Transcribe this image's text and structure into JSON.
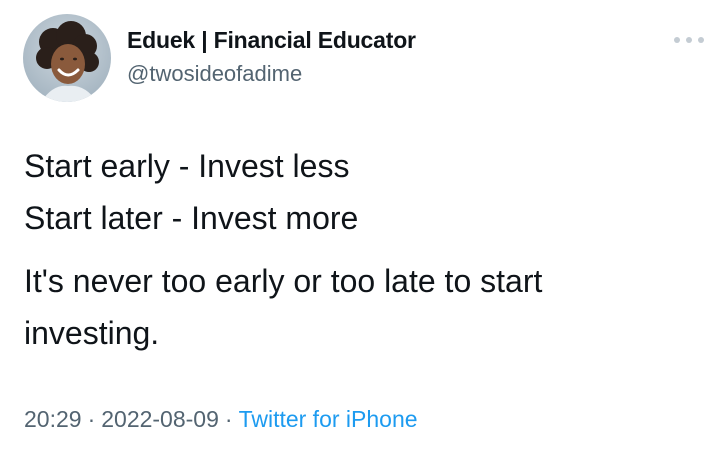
{
  "author": {
    "display_name": "Eduek | Financial Educator",
    "handle": "@twosideofadime",
    "avatar_icon": "profile-photo"
  },
  "more_icon": "more-horizontal-icon",
  "tweet": {
    "lines": [
      "Start early - Invest less",
      "Start later - Invest more",
      "It's never too early or too late to start",
      "investing."
    ]
  },
  "meta": {
    "time": "20:29",
    "separator": "·",
    "date": "2022-08-09",
    "source": "Twitter for iPhone"
  },
  "colors": {
    "text": "#0f1419",
    "secondary": "#536471",
    "link": "#1d9bf0"
  }
}
